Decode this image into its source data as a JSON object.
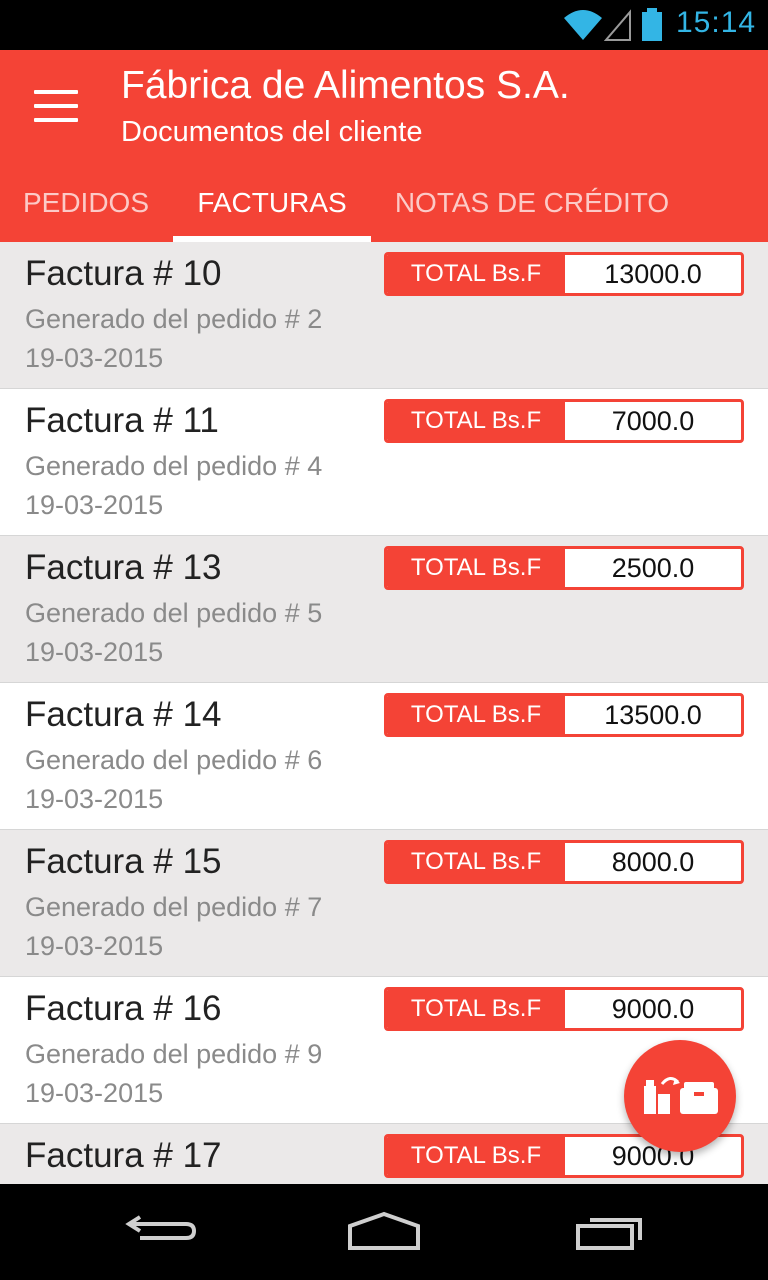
{
  "status_bar": {
    "time": "15:14"
  },
  "app_bar": {
    "title": "Fábrica de Alimentos S.A.",
    "subtitle": "Documentos del cliente",
    "menu_icon": "menu-icon"
  },
  "tabs": [
    {
      "label": "PEDIDOS",
      "active": false
    },
    {
      "label": "FACTURAS",
      "active": true
    },
    {
      "label": "NOTAS DE CRÉDITO",
      "active": false
    }
  ],
  "invoices": [
    {
      "title": "Factura # 10",
      "origin": "Generado del pedido # 2",
      "date": "19-03-2015",
      "total_label": "TOTAL Bs.F",
      "total": "13000.0"
    },
    {
      "title": "Factura # 11",
      "origin": "Generado del pedido # 4",
      "date": "19-03-2015",
      "total_label": "TOTAL Bs.F",
      "total": "7000.0"
    },
    {
      "title": "Factura # 13",
      "origin": "Generado del pedido # 5",
      "date": "19-03-2015",
      "total_label": "TOTAL Bs.F",
      "total": "2500.0"
    },
    {
      "title": "Factura # 14",
      "origin": "Generado del pedido # 6",
      "date": "19-03-2015",
      "total_label": "TOTAL Bs.F",
      "total": "13500.0"
    },
    {
      "title": "Factura # 15",
      "origin": "Generado del pedido # 7",
      "date": "19-03-2015",
      "total_label": "TOTAL Bs.F",
      "total": "8000.0"
    },
    {
      "title": "Factura # 16",
      "origin": "Generado del pedido # 9",
      "date": "19-03-2015",
      "total_label": "TOTAL Bs.F",
      "total": "9000.0"
    },
    {
      "title": "Factura # 17",
      "origin": "",
      "date": "",
      "total_label": "TOTAL Bs.F",
      "total": "9000.0"
    }
  ],
  "fab": {
    "icon": "products-to-box-icon"
  },
  "colors": {
    "primary": "#f44336",
    "status_accent": "#33b5e5",
    "row_shaded": "#ebe9e9"
  }
}
